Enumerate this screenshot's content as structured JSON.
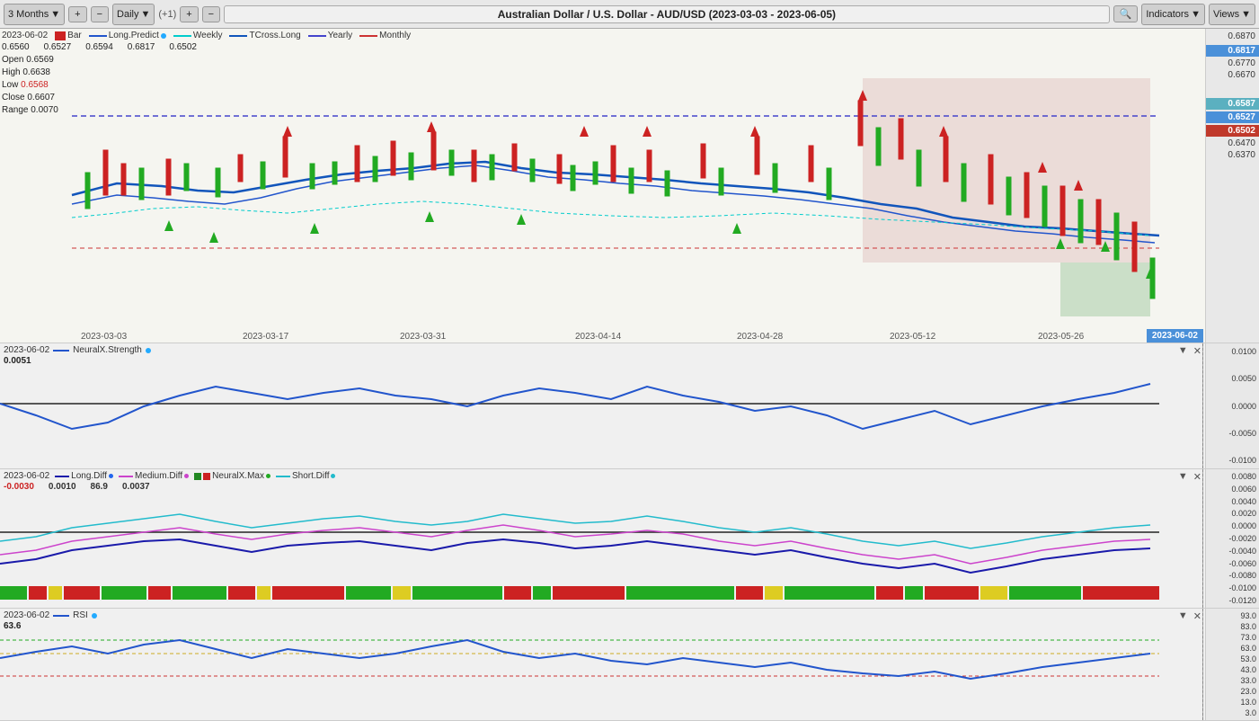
{
  "toolbar": {
    "period": "3 Months",
    "interval": "Daily",
    "increment": "(+1)",
    "title": "Australian Dollar / U.S. Dollar - AUD/USD (2023-03-03 - 2023-06-05)",
    "indicators_label": "Indicators",
    "views_label": "Views"
  },
  "main_chart": {
    "date": "2023-06-02",
    "bar_type": "Bar",
    "ohlc": {
      "open": "0.6569",
      "high": "0.6638",
      "low": "0.6568",
      "close": "0.6607",
      "range": "0.0070"
    },
    "indicators": [
      {
        "name": "Long.Predict",
        "color": "blue",
        "value": "0.6560"
      },
      {
        "name": "Weekly",
        "color": "cyan_dashed",
        "value": "0.6527"
      },
      {
        "name": "TCross.Long",
        "color": "blue_solid",
        "value": "0.6594"
      },
      {
        "name": "Yearly",
        "color": "blue_dashed",
        "value": "0.6817"
      },
      {
        "name": "Monthly",
        "color": "red_dashed",
        "value": "0.6502"
      }
    ],
    "axis_values": [
      "0.6870",
      "0.6817",
      "0.6770",
      "0.6670",
      "0.6587",
      "0.6527",
      "0.6502",
      "0.6470",
      "0.6370"
    ],
    "highlighted_values": {
      "blue": "0.6817",
      "teal": "0.6587",
      "teal2": "0.6527",
      "red": "0.6502"
    },
    "dates": [
      "2023-03-03",
      "2023-03-17",
      "2023-03-31",
      "2023-04-14",
      "2023-04-28",
      "2023-05-12",
      "2023-05-26",
      "2023-06-02"
    ]
  },
  "neuralx_panel": {
    "date": "2023-06-02",
    "name": "NeuralX.Strength",
    "value": "0.0051",
    "axis_values": [
      "0.0100",
      "0.0050",
      "0.0000",
      "-0.0050",
      "-0.0100"
    ],
    "chart_label_top": "0.0100"
  },
  "diff_panel": {
    "date": "2023-06-02",
    "indicators": [
      {
        "name": "Long.Diff",
        "color": "#1a1aaa",
        "value": "-0.0030"
      },
      {
        "name": "Medium.Diff",
        "color": "#cc44cc",
        "value": "0.0010"
      },
      {
        "name": "NeuralX.Max",
        "color": "#228822",
        "value": "86.9"
      },
      {
        "name": "Short.Diff",
        "color": "#22bbcc",
        "value": "0.0037"
      }
    ],
    "axis_values": [
      "0.0080",
      "0.0060",
      "0.0040",
      "0.0020",
      "0.0000",
      "-0.0020",
      "-0.0040",
      "-0.0060",
      "-0.0080",
      "-0.0100",
      "-0.0120"
    ]
  },
  "rsi_panel": {
    "date": "2023-06-02",
    "name": "RSI",
    "value": "63.6",
    "axis_values": [
      "93.0",
      "83.0",
      "73.0",
      "63.0",
      "53.0",
      "43.0",
      "33.0",
      "23.0",
      "13.0",
      "3.0"
    ]
  }
}
